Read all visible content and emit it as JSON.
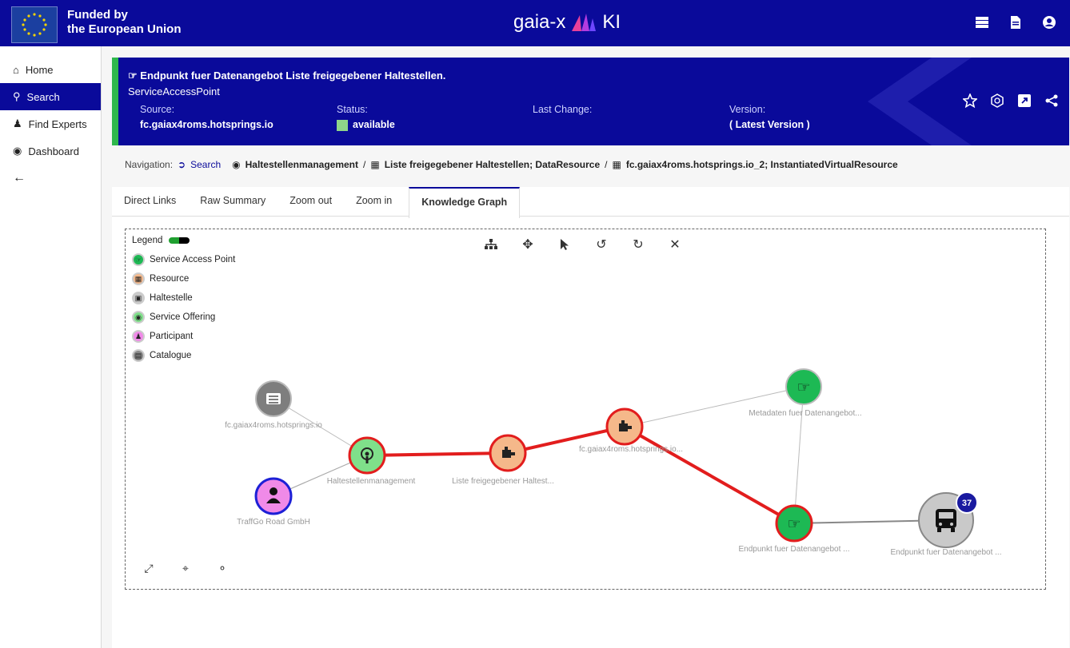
{
  "header": {
    "eu_line1": "Funded by",
    "eu_line2": "the European Union",
    "brand_left": "gaia-x",
    "brand_right": "KI",
    "icons": [
      "server-icon",
      "document-icon",
      "user-circle-icon"
    ]
  },
  "sidebar": {
    "items": [
      {
        "label": "Home",
        "icon": "home-icon"
      },
      {
        "label": "Search",
        "icon": "search-icon",
        "active": true
      },
      {
        "label": "Find Experts",
        "icon": "users-icon"
      },
      {
        "label": "Dashboard",
        "icon": "user-circle-icon"
      }
    ],
    "back_icon": "arrow-left-icon"
  },
  "banner": {
    "title": "Endpunkt fuer Datenangebot Liste freigegebener Haltestellen.",
    "type": "ServiceAccessPoint",
    "source_label": "Source:",
    "source_value": "fc.gaiax4roms.hotsprings.io",
    "status_label": "Status:",
    "status_value": "available",
    "status_color": "#8fd48a",
    "last_change_label": "Last Change:",
    "last_change_value": "",
    "version_label": "Version:",
    "version_value": "( Latest Version )",
    "actions": [
      "star-icon",
      "gaia-icon",
      "external-link-icon",
      "share-icon"
    ]
  },
  "breadcrumb": {
    "label": "Navigation:",
    "search": "Search",
    "crumbs": [
      "Haltestellenmanagement",
      "Liste freigegebener Haltestellen; DataResource",
      "fc.gaiax4roms.hotsprings.io_2; InstantiatedVirtualResource"
    ],
    "separator": "/"
  },
  "tabs": [
    "Direct Links",
    "Raw Summary",
    "Zoom out",
    "Zoom in",
    "Knowledge Graph"
  ],
  "active_tab": "Knowledge Graph",
  "legend": {
    "title": "Legend",
    "items": [
      {
        "label": "Service Access Point",
        "color": "#1db954"
      },
      {
        "label": "Resource",
        "color": "#f5b88a"
      },
      {
        "label": "Haltestelle",
        "color": "#c9c9c9"
      },
      {
        "label": "Service Offering",
        "color": "#7fe08a"
      },
      {
        "label": "Participant",
        "color": "#f08ae8"
      },
      {
        "label": "Catalogue",
        "color": "#8a8a8a"
      }
    ]
  },
  "graph_toolbar": [
    "hierarchy-icon",
    "move-icon",
    "pointer-icon",
    "undo-icon",
    "redo-icon",
    "fit-icon"
  ],
  "graph_bottom_tools": [
    "expand-icon",
    "crop-icon",
    "hide-icon"
  ],
  "graph": {
    "nodes": [
      {
        "id": "catalogue",
        "label": "fc.gaiax4roms.hotsprings.io",
        "type": "Catalogue"
      },
      {
        "id": "offering",
        "label": "Haltestellenmanagement",
        "type": "Service Offering"
      },
      {
        "id": "participant",
        "label": "TraffGo Road GmbH",
        "type": "Participant"
      },
      {
        "id": "resource1",
        "label": "Liste freigegebener Haltest...",
        "type": "Resource"
      },
      {
        "id": "resource2",
        "label": "fc.gaiax4roms.hotsprings.io...",
        "type": "Resource"
      },
      {
        "id": "sap1",
        "label": "Metadaten fuer Datenangebot...",
        "type": "Service Access Point"
      },
      {
        "id": "sap2",
        "label": "Endpunkt fuer Datenangebot ...",
        "type": "Service Access Point"
      },
      {
        "id": "stop",
        "label": "Endpunkt fuer Datenangebot ...",
        "type": "Haltestelle",
        "badge": "37"
      }
    ]
  }
}
